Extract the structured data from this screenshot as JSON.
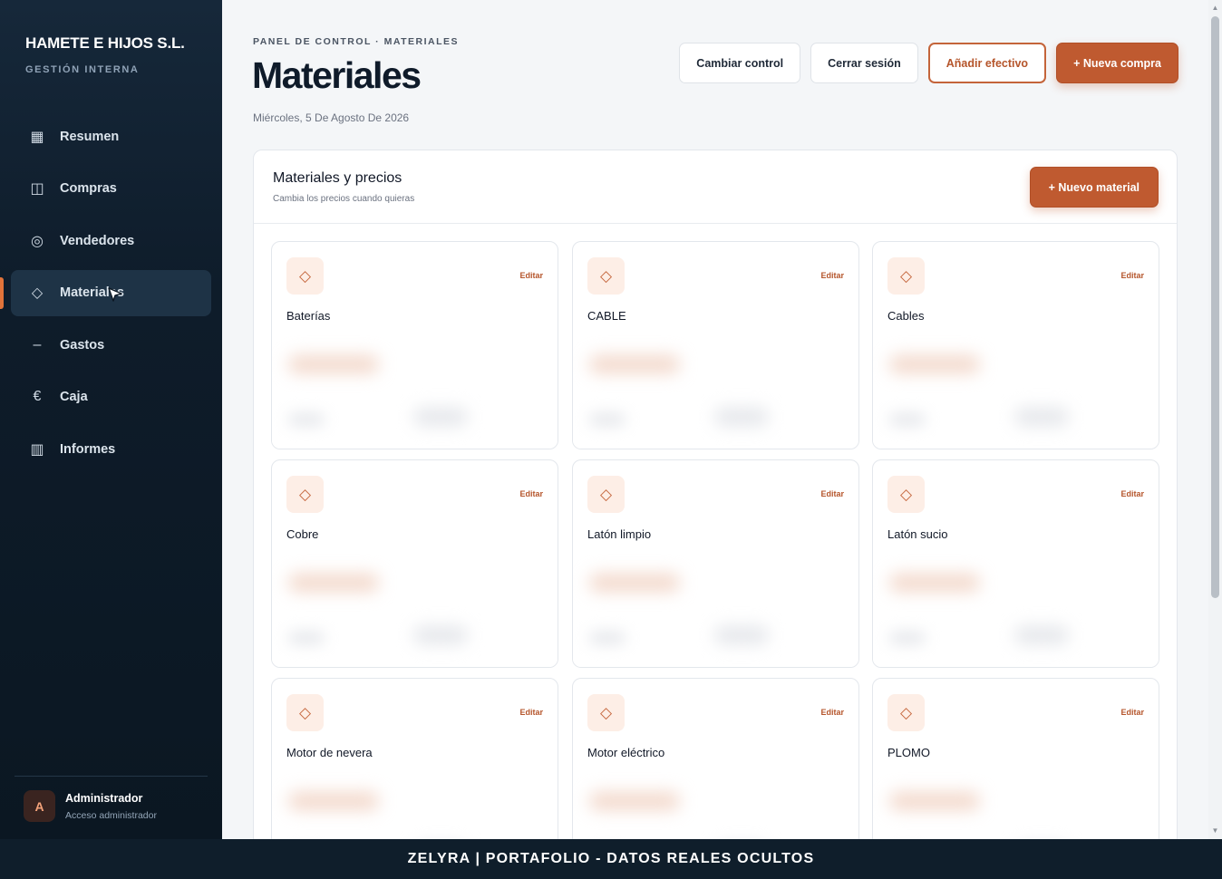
{
  "brand": {
    "name": "HAMETE E HIJOS S.L.",
    "subtitle": "GESTIÓN INTERNA"
  },
  "sidebar": {
    "items": [
      {
        "label": "Resumen",
        "icon": "grid-icon",
        "glyph": "▦",
        "active": false
      },
      {
        "label": "Compras",
        "icon": "columns-icon",
        "glyph": "◫",
        "active": false
      },
      {
        "label": "Vendedores",
        "icon": "target-icon",
        "glyph": "◎",
        "active": false
      },
      {
        "label": "Materiales",
        "icon": "diamond-icon",
        "glyph": "◇",
        "active": true
      },
      {
        "label": "Gastos",
        "icon": "minus-icon",
        "glyph": "–",
        "active": false
      },
      {
        "label": "Caja",
        "icon": "euro-icon",
        "glyph": "€",
        "active": false
      },
      {
        "label": "Informes",
        "icon": "bar-chart-icon",
        "glyph": "▥",
        "active": false
      }
    ]
  },
  "user": {
    "initial": "A",
    "name": "Administrador",
    "role": "Acceso administrador"
  },
  "header": {
    "breadcrumb": "PANEL DE CONTROL · MATERIALES",
    "title": "Materiales",
    "date": "Miércoles, 5 De Agosto De 2026",
    "actions": {
      "switch_control": "Cambiar control",
      "logout": "Cerrar sesión",
      "add_cash": "Añadir efectivo",
      "new_purchase": "+ Nueva compra"
    }
  },
  "panel": {
    "title": "Materiales y precios",
    "subtitle": "Cambia los precios cuando quieras",
    "new_button": "+ Nuevo material",
    "edit_label": "Editar",
    "materials": [
      "Baterías",
      "CABLE",
      "Cables",
      "Cobre",
      "Latón limpio",
      "Latón sucio",
      "Motor de nevera",
      "Motor eléctrico",
      "PLOMO"
    ]
  },
  "footer": {
    "text": "ZELYRA | PORTAFOLIO - DATOS REALES OCULTOS"
  },
  "colors": {
    "accent": "#bf5a30",
    "sidebar_bg": "#0e1c2a",
    "footer_bg": "#0f1e2b"
  }
}
